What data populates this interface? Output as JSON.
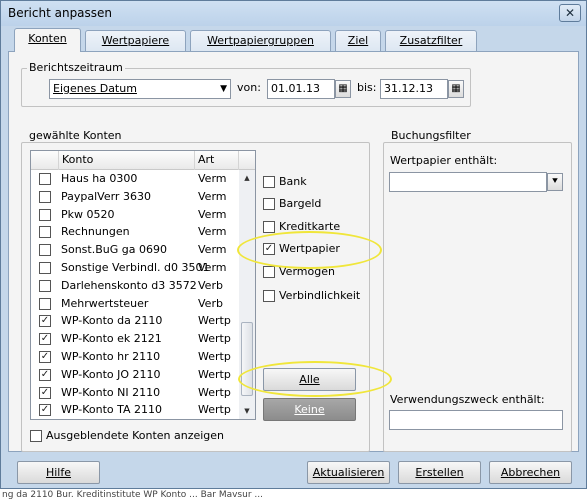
{
  "window": {
    "title": "Bericht anpassen",
    "close": "✕"
  },
  "tabs": [
    {
      "label": "Konten",
      "active": true
    },
    {
      "label": "Wertpapiere",
      "active": false
    },
    {
      "label": "Wertpapiergruppen",
      "active": false
    },
    {
      "label": "Ziel",
      "active": false
    },
    {
      "label": "Zusatzfilter",
      "active": false
    }
  ],
  "berichtszeitraum": {
    "title": "Berichtszeitraum",
    "period": "Eigenes Datum",
    "von_label": "von:",
    "von_value": "01.01.13",
    "bis_label": "bis:",
    "bis_value": "31.12.13"
  },
  "konten": {
    "title": "gewählte Konten",
    "col_konto": "Konto",
    "col_art": "Art",
    "rows": [
      {
        "konto": "Haus ha 0300",
        "art": "Verm",
        "checked": false
      },
      {
        "konto": "PaypalVerr 3630",
        "art": "Verm",
        "checked": false
      },
      {
        "konto": "Pkw 0520",
        "art": "Verm",
        "checked": false
      },
      {
        "konto": "Rechnungen",
        "art": "Verm",
        "checked": false
      },
      {
        "konto": "Sonst.BuG ga 0690",
        "art": "Verm",
        "checked": false
      },
      {
        "konto": "Sonstige Verbindl. d0 3501",
        "art": "Verm",
        "checked": false
      },
      {
        "konto": "Darlehenskonto d3 3572",
        "art": "Verb",
        "checked": false
      },
      {
        "konto": "Mehrwertsteuer",
        "art": "Verb",
        "checked": false
      },
      {
        "konto": "WP-Konto da 2110",
        "art": "Wertp",
        "checked": true
      },
      {
        "konto": "WP-Konto ek 2121",
        "art": "Wertp",
        "checked": true
      },
      {
        "konto": "WP-Konto hr 2110",
        "art": "Wertp",
        "checked": true
      },
      {
        "konto": "WP-Konto JO 2110",
        "art": "Wertp",
        "checked": true
      },
      {
        "konto": "WP-Konto NI 2110",
        "art": "Wertp",
        "checked": true
      },
      {
        "konto": "WP-Konto TA 2110",
        "art": "Wertp",
        "checked": true
      }
    ],
    "types": [
      {
        "label": "Bank",
        "checked": false
      },
      {
        "label": "Bargeld",
        "checked": false
      },
      {
        "label": "Kreditkarte",
        "checked": false
      },
      {
        "label": "Wertpapier",
        "checked": true
      },
      {
        "label": "Vermögen",
        "checked": false
      },
      {
        "label": "Verbindlichkeit",
        "checked": false
      }
    ],
    "alle": "Alle",
    "keine": "Keine",
    "show_hidden": "Ausgeblendete Konten anzeigen"
  },
  "buchungsfilter": {
    "title": "Buchungsfilter",
    "wertpapier_label": "Wertpapier enthält:",
    "wertpapier_value": "",
    "verwendung_label": "Verwendungszweck enthält:",
    "verwendung_value": ""
  },
  "buttons": {
    "hilfe": "Hilfe",
    "aktualisieren": "Aktualisieren",
    "erstellen": "Erstellen",
    "abbrechen": "Abbrechen"
  },
  "background_text": "ng da 2110    Bur. Kreditinstitute WP Konto ...    Bar      Mavsur     ..."
}
